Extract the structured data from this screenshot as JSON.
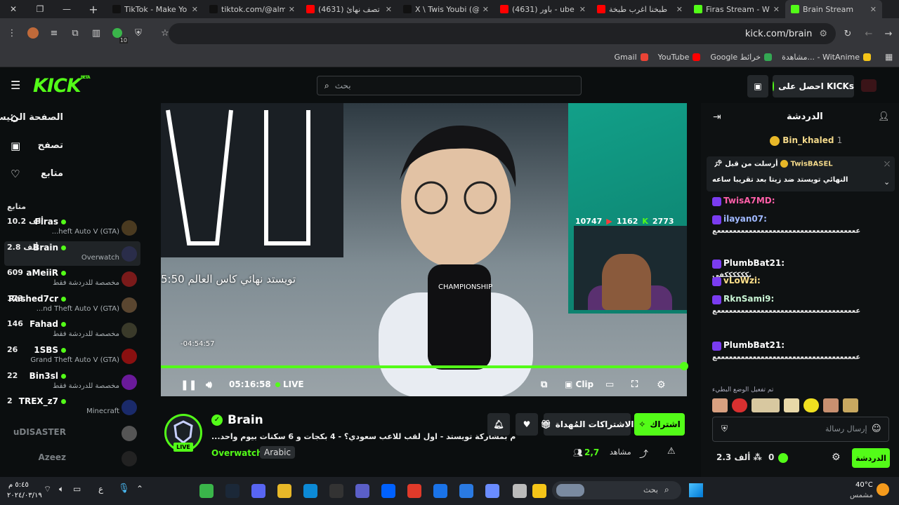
{
  "browser": {
    "tabs": [
      {
        "title": "TikTok - Make Yo",
        "color": "#111111"
      },
      {
        "title": "tiktok.com/@alm",
        "color": "#111111"
      },
      {
        "title": "(4631) تصف نهائ",
        "color": "#ff0000"
      },
      {
        "title": "X \\ Twis Youbi (@",
        "color": "#111111"
      },
      {
        "title": "(4631) باور - ube",
        "color": "#ff0000"
      },
      {
        "title": "طبخنا اغرب طبخة",
        "color": "#ff0000"
      },
      {
        "title": "Firas Stream - W",
        "color": "#53fc18"
      },
      {
        "title": "Brain Stream",
        "color": "#53fc18"
      }
    ],
    "url": "kick.com/brain",
    "extension_badge": "10",
    "bookmarks": [
      {
        "label": "Gmail",
        "color": "#ea4335"
      },
      {
        "label": "YouTube",
        "color": "#ff0000"
      },
      {
        "label": "Google خرائط",
        "color": "#34a853"
      },
      {
        "label": "مشاهدة... - WitAnime",
        "color": "#f5c518"
      }
    ]
  },
  "header": {
    "logo": "KICK",
    "logo_sup": "BETA",
    "search_placeholder": "بحث",
    "get_kicks": "احصل على KICKs"
  },
  "sidebar": {
    "nav": [
      {
        "label": "الصفحة الرئيسية",
        "icon": "home-icon"
      },
      {
        "label": "تصفح",
        "icon": "browse-icon"
      },
      {
        "label": "متابع",
        "icon": "heart-icon"
      }
    ],
    "following_heading": "متابع",
    "channels": [
      {
        "name": "Firas",
        "game": "...heft Auto V (GTA)",
        "count": "10.2 ألف",
        "live": true,
        "avatar": "#4a3a20"
      },
      {
        "name": "Brain",
        "game": "Overwatch",
        "count": "2.8 ألف",
        "live": true,
        "avatar": "#2a2d4a"
      },
      {
        "name": "aMeiiR",
        "game": "مخصصة للدردشة فقط",
        "count": "609",
        "live": true,
        "avatar": "#7a1a1a"
      },
      {
        "name": "Rashed7cr",
        "game": "...nd Theft Auto V (GTA)",
        "count": "173",
        "live": true,
        "avatar": "#5a4630"
      },
      {
        "name": "Fahad",
        "game": "مخصصة للدردشة فقط",
        "count": "146",
        "live": true,
        "avatar": "#3a3a2a"
      },
      {
        "name": "1SBS",
        "game": "Grand Theft Auto V (GTA)",
        "count": "26",
        "live": true,
        "avatar": "#8a1010"
      },
      {
        "name": "Bin3sl",
        "game": "مخصصة للدردشة فقط",
        "count": "22",
        "live": true,
        "avatar": "#6a1a9a"
      },
      {
        "name": "TREX_z7",
        "game": "Minecraft",
        "count": "2",
        "live": true,
        "avatar": "#1a2a6a"
      },
      {
        "name": "uDISASTER",
        "game": "",
        "count": "",
        "live": false,
        "avatar": "#555555"
      },
      {
        "name": "Azeez",
        "game": "",
        "count": "",
        "live": false,
        "avatar": "#222222"
      }
    ]
  },
  "video": {
    "overlay_title": "تويستد نهائي كاس العالم 5:50",
    "hover_time": "-04:54:57",
    "elapsed": "05:16:58",
    "live_label": "LIVE",
    "clip_label": "Clip",
    "pip_stats": [
      "10747",
      "1162",
      "2773"
    ],
    "progress_fraction": 1.0
  },
  "stream": {
    "channel": "Brain",
    "title": "...م بمشاركة تويستد - اول لقب للاعب سعودي؟ - 4 بكجات و 6 سكنات بيوم واحد",
    "category": "Overwatch",
    "language": "Arabic",
    "live_badge": "LIVE",
    "subscribe": "اشتراك",
    "gifted_subs": "الاشتراكات المُهداة",
    "viewers": "2,7",
    "viewers_label": "مشاهد"
  },
  "chat": {
    "title": "الدردشة",
    "top_gifter": "Bin_khaled",
    "top_gifter_rank": "1",
    "pinned_user": "TwisBASEL",
    "pinned_label": "أرسلت من قبل",
    "pinned_text": "النهائي تويستد ضد زيتا بعد تقريبا ساعه",
    "messages": [
      {
        "user": "TwisA7MD:",
        "color": "#ff5fa8",
        "text": ""
      },
      {
        "user": "ilayan07:",
        "color": "#9fb8ff",
        "text": "ععععععععععععععععععععععععععععععععععععع"
      },
      {
        "user": "PlumbBat21:",
        "color": "#ffffff",
        "text": "نككككككفى"
      },
      {
        "user": "vLoWzi:",
        "color": "#ffe08a",
        "text": ""
      },
      {
        "user": "RknSami9:",
        "color": "#c9f5d4",
        "text": "ععععععععععععععععععععععععععععععععععععع"
      },
      {
        "user": "PlumbBat21:",
        "color": "#ffffff",
        "text": "ععععععععععععععععععععععععععععععععععععع"
      }
    ],
    "slow_mode": "تم تفعيل الوضع البطيء",
    "input_placeholder": "إرسال رسالة",
    "send_label": "الدردشة",
    "points": "0",
    "followers": "2.3 ألف"
  },
  "taskbar": {
    "search_placeholder": "بحث",
    "weather_temp": "40°C",
    "weather_desc": "مشمس",
    "time": "٥:٤٥ م",
    "date": "٢٠٢٤/٠٣/١٩",
    "lang": "ع"
  }
}
